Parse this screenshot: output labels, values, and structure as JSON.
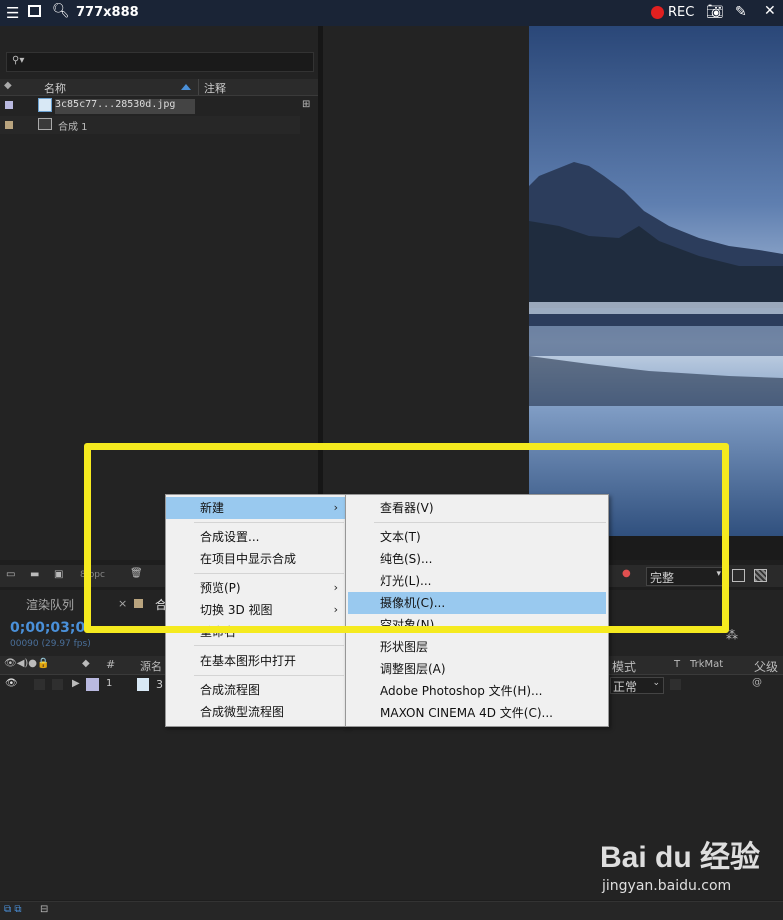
{
  "capture_bar": {
    "menu_icon": "hamburger-icon",
    "window_icon": "window-icon",
    "search_icon": "search-icon",
    "size_text": "777x888",
    "rec_label": "REC",
    "rec_color": "#e02020"
  },
  "project": {
    "search_placeholder": "",
    "columns": {
      "name": "名称",
      "comment": "注释"
    },
    "items": [
      {
        "name": "3c85c77...28530d.jpg",
        "icon": "image-file-icon",
        "swatch": "#b9b9e0"
      },
      {
        "name": "合成 1",
        "icon": "composition-icon",
        "swatch": "#b9a47e"
      }
    ],
    "footer_bpc": "8 bpc"
  },
  "viewer": {
    "quality": "完整"
  },
  "timeline": {
    "tabs": [
      "渲染队列",
      "合"
    ],
    "timecode": "0;00;03;0",
    "frames": "00090 (29.97 fps)",
    "columns": {
      "num": "#",
      "source": "源名",
      "mode": "模式",
      "t": "T",
      "trkmat": "TrkMat",
      "parent": "父级"
    },
    "layer": {
      "num": "1",
      "name": "3",
      "mode": "正常",
      "swatch": "#b9b9e0"
    }
  },
  "context_menu": {
    "items": [
      {
        "label": "新建",
        "submenu": true,
        "highlight": true
      },
      {
        "label": "合成设置..."
      },
      {
        "label": "在项目中显示合成"
      },
      {
        "label": "预览(P)",
        "submenu": true
      },
      {
        "label": "切换 3D 视图",
        "submenu": true
      },
      {
        "label": "重命名"
      },
      {
        "label": "在基本图形中打开"
      },
      {
        "label": "合成流程图"
      },
      {
        "label": "合成微型流程图"
      }
    ]
  },
  "submenu": {
    "items": [
      {
        "label": "查看器(V)"
      },
      {
        "label": "文本(T)"
      },
      {
        "label": "纯色(S)..."
      },
      {
        "label": "灯光(L)..."
      },
      {
        "label": "摄像机(C)...",
        "highlight": true
      },
      {
        "label": "空对象(N)"
      },
      {
        "label": "形状图层"
      },
      {
        "label": "调整图层(A)"
      },
      {
        "label": "Adobe Photoshop 文件(H)..."
      },
      {
        "label": "MAXON CINEMA 4D 文件(C)..."
      }
    ]
  },
  "watermark": {
    "brand": "Bai du 经验",
    "url": "jingyan.baidu.com"
  }
}
